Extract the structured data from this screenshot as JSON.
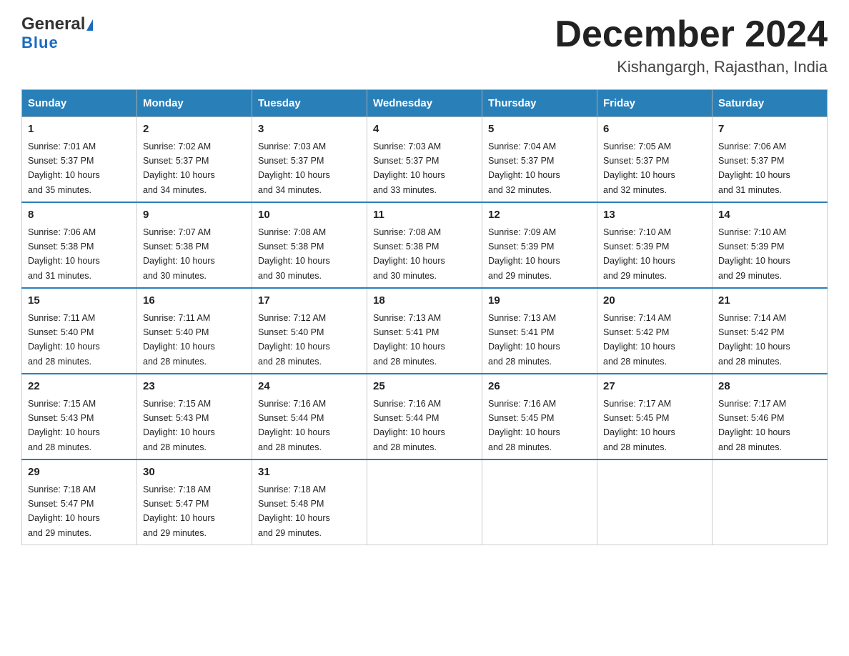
{
  "logo": {
    "general": "General",
    "blue": "Blue"
  },
  "title": "December 2024",
  "subtitle": "Kishangargh, Rajasthan, India",
  "days_of_week": [
    "Sunday",
    "Monday",
    "Tuesday",
    "Wednesday",
    "Thursday",
    "Friday",
    "Saturday"
  ],
  "weeks": [
    [
      {
        "day": "1",
        "sunrise": "7:01 AM",
        "sunset": "5:37 PM",
        "daylight": "10 hours and 35 minutes."
      },
      {
        "day": "2",
        "sunrise": "7:02 AM",
        "sunset": "5:37 PM",
        "daylight": "10 hours and 34 minutes."
      },
      {
        "day": "3",
        "sunrise": "7:03 AM",
        "sunset": "5:37 PM",
        "daylight": "10 hours and 34 minutes."
      },
      {
        "day": "4",
        "sunrise": "7:03 AM",
        "sunset": "5:37 PM",
        "daylight": "10 hours and 33 minutes."
      },
      {
        "day": "5",
        "sunrise": "7:04 AM",
        "sunset": "5:37 PM",
        "daylight": "10 hours and 32 minutes."
      },
      {
        "day": "6",
        "sunrise": "7:05 AM",
        "sunset": "5:37 PM",
        "daylight": "10 hours and 32 minutes."
      },
      {
        "day": "7",
        "sunrise": "7:06 AM",
        "sunset": "5:37 PM",
        "daylight": "10 hours and 31 minutes."
      }
    ],
    [
      {
        "day": "8",
        "sunrise": "7:06 AM",
        "sunset": "5:38 PM",
        "daylight": "10 hours and 31 minutes."
      },
      {
        "day": "9",
        "sunrise": "7:07 AM",
        "sunset": "5:38 PM",
        "daylight": "10 hours and 30 minutes."
      },
      {
        "day": "10",
        "sunrise": "7:08 AM",
        "sunset": "5:38 PM",
        "daylight": "10 hours and 30 minutes."
      },
      {
        "day": "11",
        "sunrise": "7:08 AM",
        "sunset": "5:38 PM",
        "daylight": "10 hours and 30 minutes."
      },
      {
        "day": "12",
        "sunrise": "7:09 AM",
        "sunset": "5:39 PM",
        "daylight": "10 hours and 29 minutes."
      },
      {
        "day": "13",
        "sunrise": "7:10 AM",
        "sunset": "5:39 PM",
        "daylight": "10 hours and 29 minutes."
      },
      {
        "day": "14",
        "sunrise": "7:10 AM",
        "sunset": "5:39 PM",
        "daylight": "10 hours and 29 minutes."
      }
    ],
    [
      {
        "day": "15",
        "sunrise": "7:11 AM",
        "sunset": "5:40 PM",
        "daylight": "10 hours and 28 minutes."
      },
      {
        "day": "16",
        "sunrise": "7:11 AM",
        "sunset": "5:40 PM",
        "daylight": "10 hours and 28 minutes."
      },
      {
        "day": "17",
        "sunrise": "7:12 AM",
        "sunset": "5:40 PM",
        "daylight": "10 hours and 28 minutes."
      },
      {
        "day": "18",
        "sunrise": "7:13 AM",
        "sunset": "5:41 PM",
        "daylight": "10 hours and 28 minutes."
      },
      {
        "day": "19",
        "sunrise": "7:13 AM",
        "sunset": "5:41 PM",
        "daylight": "10 hours and 28 minutes."
      },
      {
        "day": "20",
        "sunrise": "7:14 AM",
        "sunset": "5:42 PM",
        "daylight": "10 hours and 28 minutes."
      },
      {
        "day": "21",
        "sunrise": "7:14 AM",
        "sunset": "5:42 PM",
        "daylight": "10 hours and 28 minutes."
      }
    ],
    [
      {
        "day": "22",
        "sunrise": "7:15 AM",
        "sunset": "5:43 PM",
        "daylight": "10 hours and 28 minutes."
      },
      {
        "day": "23",
        "sunrise": "7:15 AM",
        "sunset": "5:43 PM",
        "daylight": "10 hours and 28 minutes."
      },
      {
        "day": "24",
        "sunrise": "7:16 AM",
        "sunset": "5:44 PM",
        "daylight": "10 hours and 28 minutes."
      },
      {
        "day": "25",
        "sunrise": "7:16 AM",
        "sunset": "5:44 PM",
        "daylight": "10 hours and 28 minutes."
      },
      {
        "day": "26",
        "sunrise": "7:16 AM",
        "sunset": "5:45 PM",
        "daylight": "10 hours and 28 minutes."
      },
      {
        "day": "27",
        "sunrise": "7:17 AM",
        "sunset": "5:45 PM",
        "daylight": "10 hours and 28 minutes."
      },
      {
        "day": "28",
        "sunrise": "7:17 AM",
        "sunset": "5:46 PM",
        "daylight": "10 hours and 28 minutes."
      }
    ],
    [
      {
        "day": "29",
        "sunrise": "7:18 AM",
        "sunset": "5:47 PM",
        "daylight": "10 hours and 29 minutes."
      },
      {
        "day": "30",
        "sunrise": "7:18 AM",
        "sunset": "5:47 PM",
        "daylight": "10 hours and 29 minutes."
      },
      {
        "day": "31",
        "sunrise": "7:18 AM",
        "sunset": "5:48 PM",
        "daylight": "10 hours and 29 minutes."
      },
      null,
      null,
      null,
      null
    ]
  ],
  "labels": {
    "sunrise": "Sunrise:",
    "sunset": "Sunset:",
    "daylight": "Daylight:"
  }
}
